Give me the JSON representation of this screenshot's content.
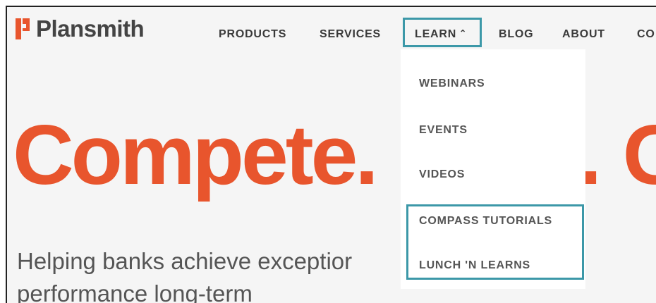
{
  "brand": {
    "name": "Plansmith",
    "logo_color": "#e8552d"
  },
  "nav": {
    "products": "PRODUCTS",
    "services": "SERVICES",
    "learn": "LEARN",
    "learn_caret": "⌃",
    "blog": "BLOG",
    "about": "ABOUT",
    "contact_partial": "CO"
  },
  "dropdown": {
    "items": [
      {
        "label": "WEBINARS"
      },
      {
        "label": "EVENTS"
      },
      {
        "label": "VIDEOS"
      },
      {
        "label": "COMPASS TUTORIALS"
      },
      {
        "label": "LUNCH 'N LEARNS"
      }
    ]
  },
  "hero": {
    "headline": "Compete.",
    "headline_right_partial": ". G",
    "sub_line1": "Helping banks achieve exceptior",
    "sub_line2": "performance long-term"
  },
  "colors": {
    "accent": "#e8552d",
    "highlight": "#3c98a8",
    "text": "#3a3a3a"
  }
}
